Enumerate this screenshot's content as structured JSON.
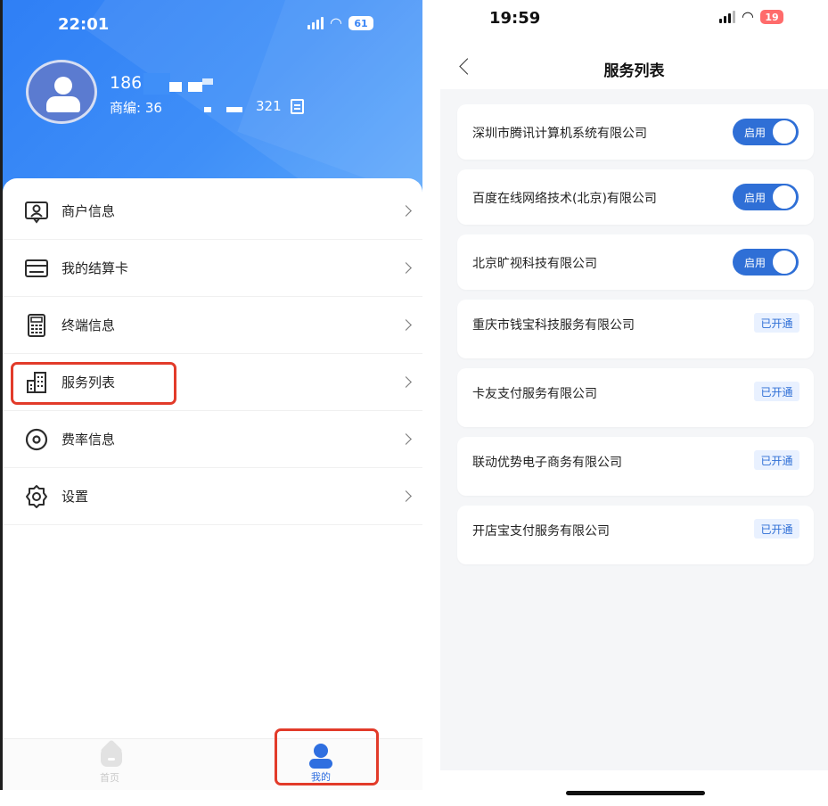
{
  "left_screen": {
    "status_bar": {
      "time": "22:01",
      "battery": "61"
    },
    "profile": {
      "phone": "186",
      "merchant_prefix": "商编: 36",
      "merchant_suffix": "321"
    },
    "menu": [
      {
        "label": "商户信息",
        "icon": "merchant-info-icon"
      },
      {
        "label": "我的结算卡",
        "icon": "bank-card-icon"
      },
      {
        "label": "终端信息",
        "icon": "terminal-icon"
      },
      {
        "label": "服务列表",
        "icon": "service-list-icon"
      },
      {
        "label": "费率信息",
        "icon": "rate-icon"
      },
      {
        "label": "设置",
        "icon": "gear-icon"
      }
    ],
    "tabs": {
      "home": "首页",
      "mine": "我的"
    },
    "annotation_color": "#e23b2a",
    "accent_color": "#2f7ff5"
  },
  "right_screen": {
    "status_bar": {
      "time": "19:59",
      "battery": "19"
    },
    "title": "服务列表",
    "services": [
      {
        "name": "深圳市腾讯计算机系统有限公司",
        "status": "启用"
      },
      {
        "name": "百度在线网络技术(北京)有限公司",
        "status": "启用"
      },
      {
        "name": "北京旷视科技有限公司",
        "status": "启用"
      },
      {
        "name": "重庆市钱宝科技服务有限公司",
        "status": "已开通"
      },
      {
        "name": "卡友支付服务有限公司",
        "status": "已开通"
      },
      {
        "name": "联动优势电子商务有限公司",
        "status": "已开通"
      },
      {
        "name": "开店宝支付服务有限公司",
        "status": "已开通"
      }
    ],
    "toggle_color": "#2f6fd6"
  }
}
